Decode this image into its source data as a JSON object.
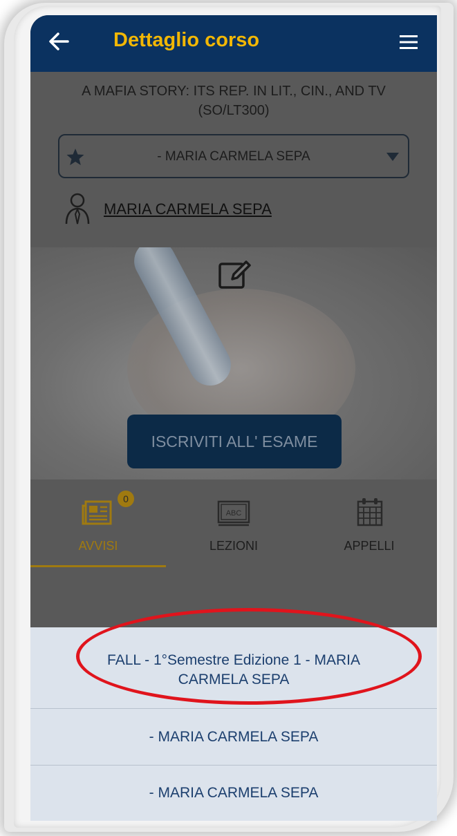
{
  "header": {
    "title": "Dettaglio corso",
    "back_icon": "arrow-left-icon",
    "menu_icon": "hamburger-menu-icon"
  },
  "course": {
    "title_line1": "A MAFIA STORY: ITS REP. IN LIT., CIN., AND TV",
    "title_line2": "(SO/LT300)"
  },
  "teacher_select": {
    "value": "- MARIA CARMELA SEPA",
    "icon": "star-icon"
  },
  "teacher_link": "MARIA CARMELA SEPA",
  "hero": {
    "button_label": "ISCRIVITI ALL' ESAME",
    "icon": "edit-icon"
  },
  "tabs": [
    {
      "label": "AVVISI",
      "icon": "newspaper-icon",
      "badge": "0",
      "active": true
    },
    {
      "label": "LEZIONI",
      "icon": "abc-board-icon"
    },
    {
      "label": "APPELLI",
      "icon": "calendar-icon"
    }
  ],
  "sheet": {
    "options": [
      "FALL - 1°Semestre Edizione 1 - MARIA CARMELA SEPA",
      "- MARIA CARMELA SEPA",
      "- MARIA CARMELA SEPA"
    ]
  },
  "colors": {
    "header_bg": "#0b3260",
    "accent": "#f2b705",
    "annotation": "#e0141c",
    "sheet_bg": "#dce3ec"
  }
}
